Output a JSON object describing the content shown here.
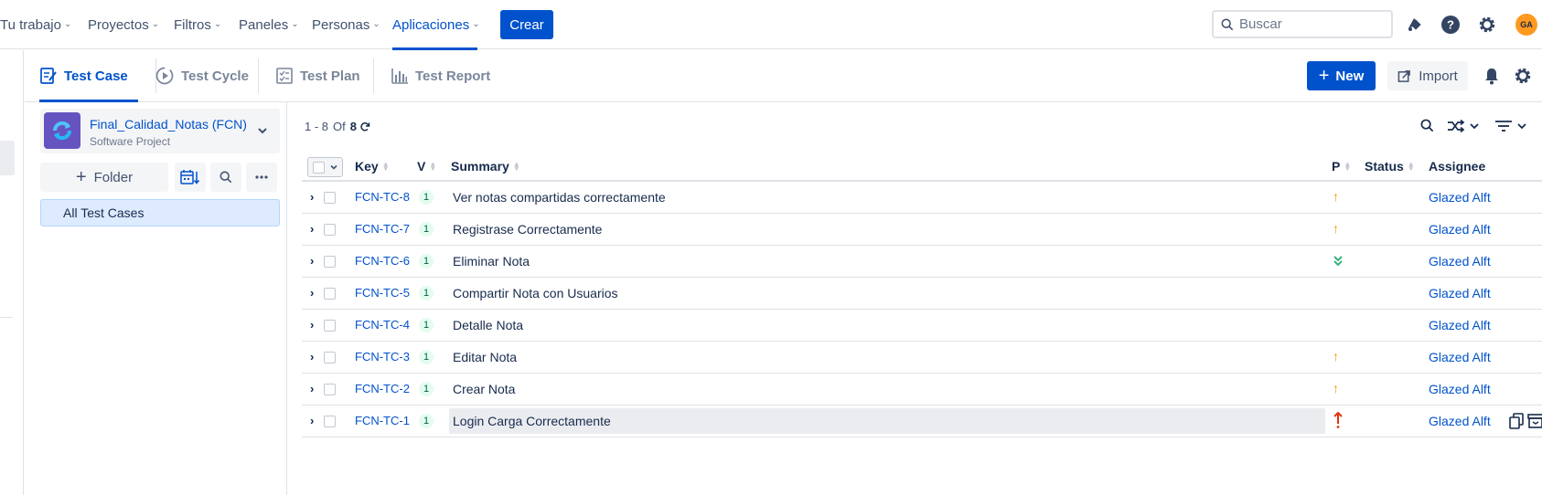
{
  "topnav": {
    "items": [
      {
        "label": "Tu trabajo"
      },
      {
        "label": "Proyectos"
      },
      {
        "label": "Filtros"
      },
      {
        "label": "Paneles"
      },
      {
        "label": "Personas"
      },
      {
        "label": "Aplicaciones",
        "active": true
      }
    ],
    "create_label": "Crear",
    "search_placeholder": "Buscar",
    "avatar_initials": "GA"
  },
  "tabs": [
    {
      "label": "Test Case",
      "active": true
    },
    {
      "label": "Test Cycle"
    },
    {
      "label": "Test Plan"
    },
    {
      "label": "Test Report"
    }
  ],
  "actions": {
    "new_label": "New",
    "import_label": "Import"
  },
  "project": {
    "name": "Final_Calidad_Notas (FCN)",
    "type": "Software Project"
  },
  "folder_panel": {
    "folder_button_label": "Folder",
    "all_tests_label": "All Test Cases"
  },
  "pagination": {
    "range": "1 - 8",
    "of_label": "Of",
    "total": "8"
  },
  "table": {
    "columns": {
      "key": "Key",
      "version": "V",
      "summary": "Summary",
      "priority": "P",
      "status": "Status",
      "assignee": "Assignee"
    },
    "rows": [
      {
        "key": "FCN-TC-8",
        "version": "1",
        "summary": "Ver notas compartidas correctamente",
        "priority": "medium",
        "status": "",
        "assignee": "Glazed Alft"
      },
      {
        "key": "FCN-TC-7",
        "version": "1",
        "summary": "Registrase Correctamente",
        "priority": "medium",
        "status": "",
        "assignee": "Glazed Alft"
      },
      {
        "key": "FCN-TC-6",
        "version": "1",
        "summary": "Eliminar Nota",
        "priority": "lowest",
        "status": "",
        "assignee": "Glazed Alft"
      },
      {
        "key": "FCN-TC-5",
        "version": "1",
        "summary": "Compartir Nota con Usuarios",
        "priority": "",
        "status": "",
        "assignee": "Glazed Alft"
      },
      {
        "key": "FCN-TC-4",
        "version": "1",
        "summary": "Detalle Nota",
        "priority": "",
        "status": "",
        "assignee": "Glazed Alft"
      },
      {
        "key": "FCN-TC-3",
        "version": "1",
        "summary": "Editar Nota",
        "priority": "medium",
        "status": "",
        "assignee": "Glazed Alft"
      },
      {
        "key": "FCN-TC-2",
        "version": "1",
        "summary": "Crear Nota",
        "priority": "medium",
        "status": "",
        "assignee": "Glazed Alft"
      },
      {
        "key": "FCN-TC-1",
        "version": "1",
        "summary": "Login Carga Correctamente",
        "priority": "highest",
        "status": "",
        "assignee": "Glazed Alft",
        "hovered": true
      }
    ]
  },
  "colors": {
    "brand": "#0052cc",
    "prio_medium": "#ff8b00",
    "prio_low": "#36b37e",
    "prio_highest": "#de350b",
    "avatar": "#ff991f"
  }
}
